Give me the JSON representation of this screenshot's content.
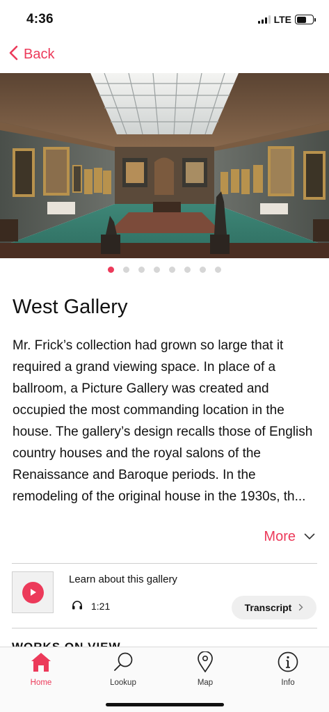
{
  "status_bar": {
    "time": "4:36",
    "network": "LTE",
    "signal_bars": 3
  },
  "nav": {
    "back_label": "Back",
    "back_icon": "chevron-left-icon"
  },
  "gallery_image": {
    "alt": "West Gallery photo",
    "pager_count": 8,
    "pager_active": 0
  },
  "title": "West Gallery",
  "description": "Mr. Frick’s collection had grown so large that it required a grand viewing space. In place of a ballroom, a Picture Gallery was created and occupied the most commanding location in the house. The gallery’s design recalls those of English country houses and the royal salons of the Renaissance and Baroque periods. In the remodeling of the original house in the 1930s, th...",
  "more": {
    "label": "More",
    "icon": "chevron-down-icon"
  },
  "audio": {
    "title": "Learn about this gallery",
    "duration": "1:21",
    "transcript_label": "Transcript",
    "play_icon": "play-icon",
    "headphones_icon": "headphones-icon"
  },
  "section_peek": "WORKS ON VIEW",
  "tabs": [
    {
      "label": "Home",
      "icon": "home-icon",
      "active": true
    },
    {
      "label": "Lookup",
      "icon": "search-icon",
      "active": false
    },
    {
      "label": "Map",
      "icon": "map-pin-icon",
      "active": false
    },
    {
      "label": "Info",
      "icon": "info-icon",
      "active": false
    }
  ],
  "colors": {
    "accent": "#ec3a5a",
    "text": "#111111",
    "divider": "#cfcfcf"
  }
}
